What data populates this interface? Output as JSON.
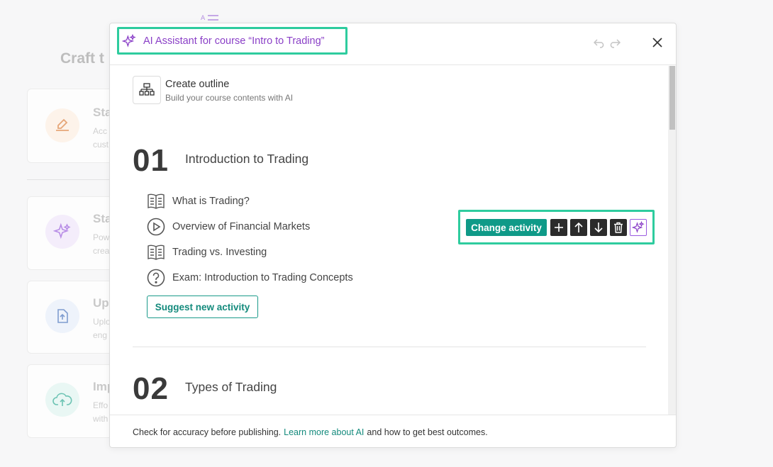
{
  "background": {
    "title": "Craft t",
    "cards": [
      {
        "title": "Sta",
        "desc_1": "Acc",
        "desc_2": "cust",
        "icon": "pencil-icon"
      },
      {
        "title": "Sta",
        "desc_1": "Pow",
        "desc_2": "crea",
        "icon": "sparkle-icon"
      },
      {
        "title": "Up",
        "desc_1": "Uplo",
        "desc_2": "eng",
        "icon": "upload-file-icon"
      },
      {
        "title": "Imp",
        "desc_1": "Effo",
        "desc_2": "with",
        "icon": "cloud-upload-icon"
      }
    ]
  },
  "modal": {
    "title": "AI Assistant for course “Intro to Trading”",
    "outline": {
      "title": "Create outline",
      "subtitle": "Build your course contents with AI"
    },
    "sections": [
      {
        "number": "01",
        "title": "Introduction to Trading",
        "activities": [
          {
            "label": "What is Trading?",
            "icon": "book-icon"
          },
          {
            "label": "Overview of Financial Markets",
            "icon": "play-icon"
          },
          {
            "label": "Trading vs. Investing",
            "icon": "book-icon"
          },
          {
            "label": "Exam: Introduction to Trading Concepts",
            "icon": "question-icon"
          }
        ],
        "suggest_label": "Suggest new activity"
      },
      {
        "number": "02",
        "title": "Types of Trading"
      }
    ],
    "toolbar": {
      "change_label": "Change activity"
    },
    "footer": {
      "text_before": "Check for accuracy before publishing.",
      "link": "Learn more about AI",
      "text_after": "and how to get best outcomes."
    }
  },
  "colors": {
    "accent": "#0f9a88",
    "ai_purple": "#8a3fc7",
    "highlight": "#2ecc9e"
  }
}
